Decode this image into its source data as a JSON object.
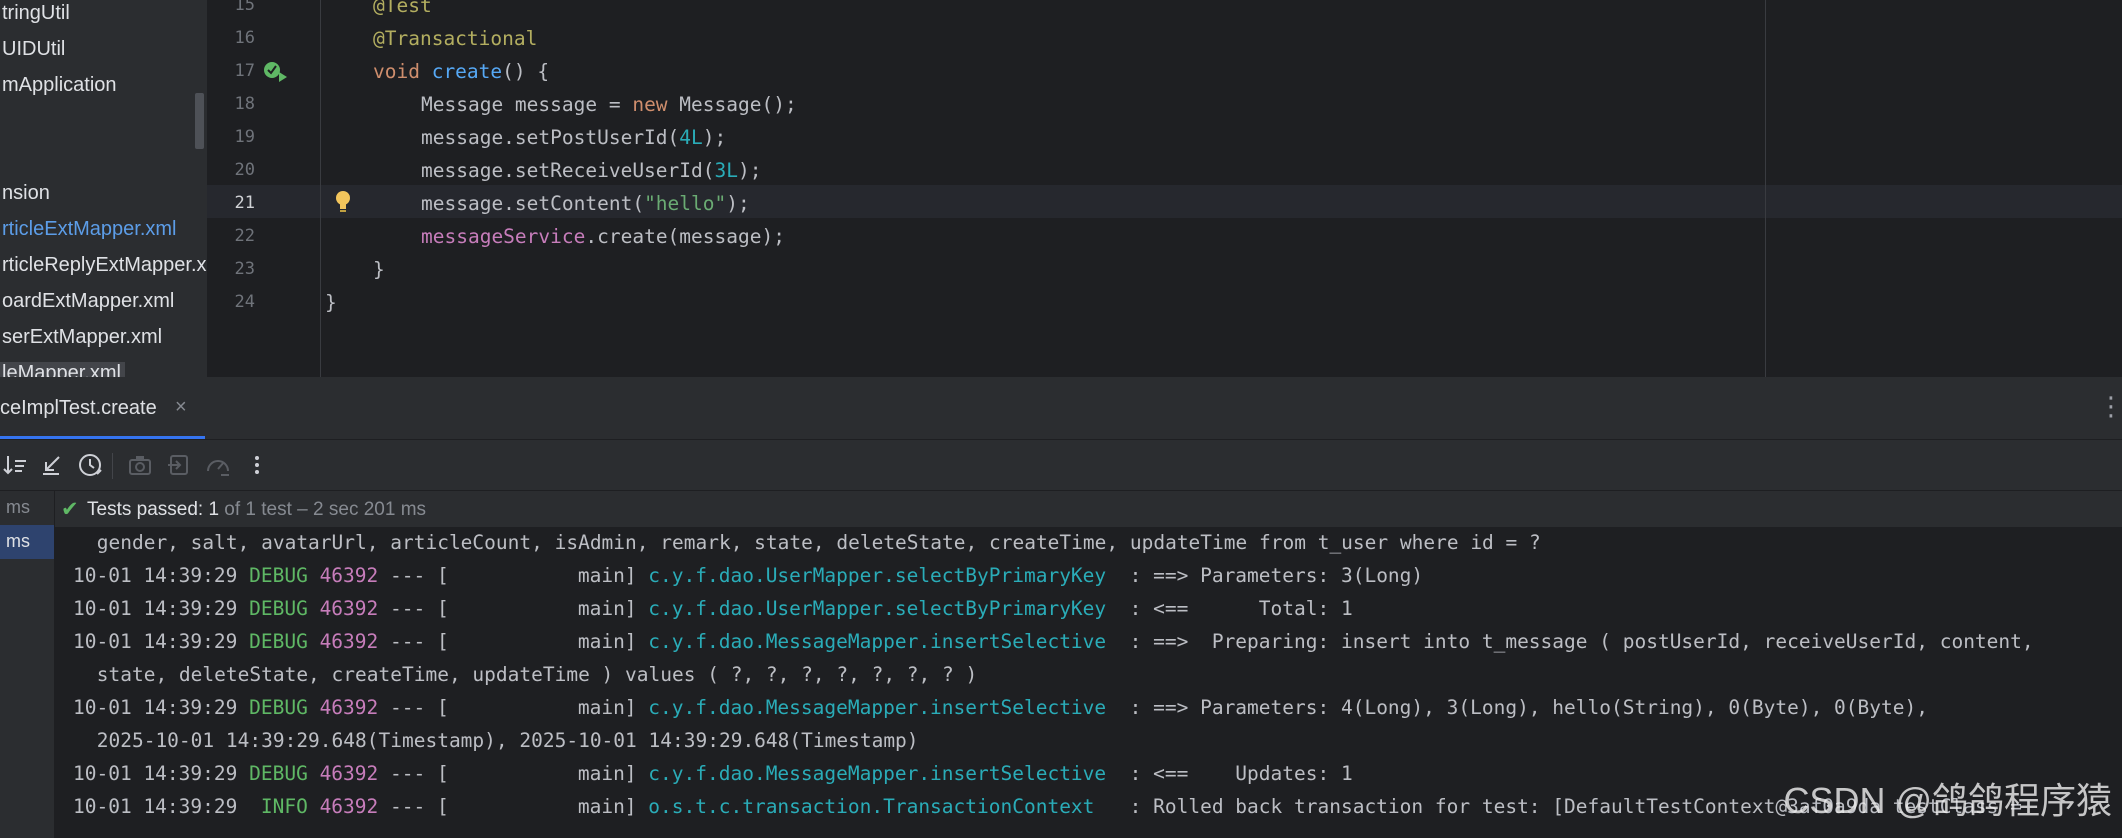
{
  "project_tree": {
    "items": [
      {
        "label": "tringUtil",
        "highlight": "none"
      },
      {
        "label": "UIDUtil",
        "highlight": "none"
      },
      {
        "label": "mApplication",
        "highlight": "none"
      },
      {
        "label": "nsion",
        "highlight": "none"
      },
      {
        "label": "rticleExtMapper.xml",
        "highlight": "blue"
      },
      {
        "label": "rticleReplyExtMapper.x",
        "highlight": "none"
      },
      {
        "label": "oardExtMapper.xml",
        "highlight": "none"
      },
      {
        "label": "serExtMapper.xml",
        "highlight": "none"
      },
      {
        "label": "leMapper.xml",
        "highlight": "selected"
      }
    ]
  },
  "editor": {
    "line_numbers": [
      "15",
      "16",
      "17",
      "18",
      "19",
      "20",
      "21",
      "22",
      "23",
      "24"
    ],
    "current_line": "21",
    "gutter_icons": {
      "run_test_line": "17",
      "intention_bulb_line": "21"
    },
    "code": {
      "l15": {
        "ann": "@Test"
      },
      "l16": {
        "ann": "@Transactional"
      },
      "l17": {
        "kw": "void ",
        "fn": "create",
        "rest": "() {"
      },
      "l18": {
        "a": "Message message = ",
        "kw": "new",
        "b": " Message();"
      },
      "l19": {
        "a": "message.setPostUserId(",
        "num": "4L",
        "b": ");"
      },
      "l20": {
        "a": "message.setReceiveUserId(",
        "num": "3L",
        "b": ");"
      },
      "l21": {
        "a": "message.setContent(",
        "str": "\"hello\"",
        "b": ");"
      },
      "l22": {
        "fld": "messageService",
        "b": ".create(message);"
      },
      "l23": "}",
      "l24": "}"
    }
  },
  "run_panel": {
    "tab_label": "ceImplTest.create",
    "tab_close": "×",
    "more_icon": "⋮",
    "toolbar_icons": [
      "sort-icon",
      "collapse-icon",
      "history-icon",
      "screenshot-icon",
      "import-icon",
      "speedometer-icon",
      "more-icon"
    ],
    "status": {
      "passed": "Tests passed: 1",
      "detail": " of 1 test – 2 sec 201 ms"
    },
    "test_tree": [
      {
        "label": "ms",
        "selected": false
      },
      {
        "label": "ms",
        "selected": true
      }
    ],
    "console": {
      "l0": " gender, salt, avatarUrl, articleCount, isAdmin, remark, state, deleteState, createTime, updateTime from t_user where id = ?",
      "l1": {
        "ts": "10-01 14:39:29 ",
        "lv": "DEBUG",
        "pid": "46392",
        "th": " --- [           main] ",
        "lg": "c.y.f.dao.UserMapper.selectByPrimaryKey",
        "msg": "  : ==> Parameters: 3(Long)"
      },
      "l2": {
        "ts": "10-01 14:39:29 ",
        "lv": "DEBUG",
        "pid": "46392",
        "th": " --- [           main] ",
        "lg": "c.y.f.dao.UserMapper.selectByPrimaryKey",
        "msg": "  : <==      Total: 1"
      },
      "l3": {
        "ts": "10-01 14:39:29 ",
        "lv": "DEBUG",
        "pid": "46392",
        "th": " --- [           main] ",
        "lg": "c.y.f.dao.MessageMapper.insertSelective",
        "msg": "  : ==>  Preparing: insert into t_message ( postUserId, receiveUserId, content,"
      },
      "l4": " state, deleteState, createTime, updateTime ) values ( ?, ?, ?, ?, ?, ?, ? )",
      "l5": {
        "ts": "10-01 14:39:29 ",
        "lv": "DEBUG",
        "pid": "46392",
        "th": " --- [           main] ",
        "lg": "c.y.f.dao.MessageMapper.insertSelective",
        "msg": "  : ==> Parameters: 4(Long), 3(Long), hello(String), 0(Byte), 0(Byte),"
      },
      "l6": " 2025-10-01 14:39:29.648(Timestamp), 2025-10-01 14:39:29.648(Timestamp)",
      "l7": {
        "ts": "10-01 14:39:29 ",
        "lv": "DEBUG",
        "pid": "46392",
        "th": " --- [           main] ",
        "lg": "c.y.f.dao.MessageMapper.insertSelective",
        "msg": "  : <==    Updates: 1"
      },
      "l8": {
        "ts": "10-01 14:39:29 ",
        "lv": " INFO",
        "pid": "46392",
        "th": " --- [           main] ",
        "lg": "o.s.t.c.transaction.TransactionContext  ",
        "msg": " : Rolled back transaction for test: [DefaultTestContext@3af0a9da testClass ="
      }
    }
  },
  "watermark": "CSDN @鸽鸽程序猿",
  "colors": {
    "accent": "#3574f0",
    "passed": "#5fb865",
    "keyword": "#cf8e6d",
    "annotation": "#b3ae60",
    "number": "#2aacb8",
    "string": "#6aab73"
  }
}
